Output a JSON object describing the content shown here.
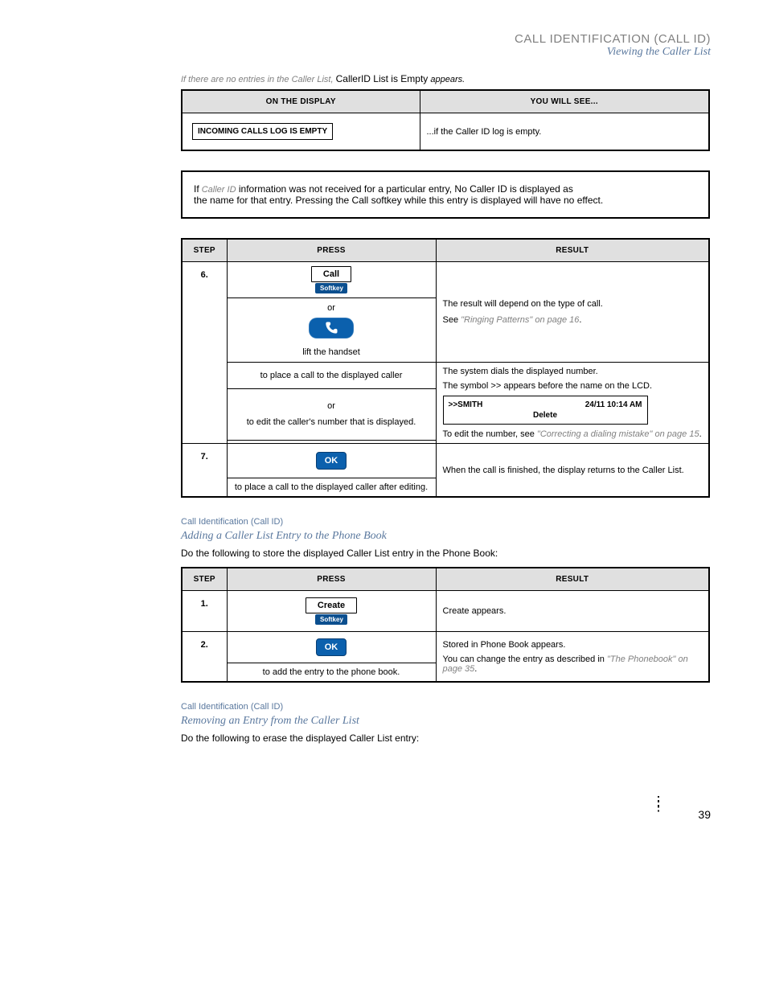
{
  "page": {
    "title": "CALL IDENTIFICATION (CALL ID)",
    "subtitle": "Viewing the Caller List",
    "footer_page": "39"
  },
  "empty_note_prefix": "If there are no entries in the Caller List, ",
  "empty_note_black": "CallerID List is Empty",
  "empty_note_suffix": " appears.",
  "col_step": "Step",
  "col_press": "Press",
  "col_result": "Result",
  "tbl1": {
    "header_left": "ON THE DISPLAY",
    "header_right": "YOU WILL SEE...",
    "empty_log": "INCOMING CALLS LOG IS EMPTY",
    "result": "...if the Caller ID log is empty."
  },
  "msg": {
    "l1_start": "If",
    "l1_em": " Caller ID",
    "l1_end": " information was not received for a particular entry, ",
    "l1_code": "No Caller ID",
    "l1_after": " is displayed as",
    "l2": "the name for that entry. Pressing the",
    "l2_code": " Call",
    "l2_end": " softkey while this entry is displayed will have no effect."
  },
  "tbl2": {
    "r1_step": "6.",
    "r1_softkey": "Call",
    "r1_sub": "Softkey",
    "r1_or": "or",
    "r1_alt": "lift the handset",
    "r1_below": "to place a call to the displayed caller",
    "r1_res1": "The result will depend on the type of call.",
    "r1_res2": "See ",
    "r1_res2_link": "\"Ringing Patterns\" on page 16",
    "r1_res2_end": ".",
    "r2_or": "or",
    "r2_alt": "to edit the caller's number that is displayed.",
    "r2_res_top": "The system dials the displayed number.",
    "r2_res_mid": "The symbol ",
    "r2_res_mid_code": ">>",
    "r2_res_mid_end": " appears before the name on the LCD.",
    "lcd_name": ">>SMITH",
    "lcd_time": "24/11 10:14 AM",
    "lcd_line2": "Delete",
    "r2_res_bot_start": "To edit the number, see",
    "r2_res_bot_link": " \"Correcting a dialing mistake\" on page 15",
    "r2_res_bot_end": ".",
    "r3_step": "7.",
    "r3_ok": "OK",
    "r3_alt": "to place a call to the displayed caller after editing.",
    "r3_res": "When the call is finished, the display returns to the Caller List."
  },
  "sec2": {
    "breadcrumb": "Call Identification (Call ID)",
    "heading": "Adding a Caller List Entry to the Phone Book",
    "intro": "Do the following to store the displayed Caller List entry in the Phone Book:"
  },
  "tbl3": {
    "r1_step": "1.",
    "r1_softkey": "Create",
    "r1_sub": "Softkey",
    "r1_res_start": "Create",
    "r1_res_end": " appears.",
    "r2_step": "2.",
    "r2_ok": "OK",
    "r2_alt": "to add the entry to the phone book.",
    "r2_res1_code": "Stored in Phone Book",
    "r2_res1_end": " appears.",
    "r2_res2_start": "You can change the entry as described in",
    "r2_res2_link": " \"The Phonebook\" on page 35",
    "r2_res2_end": "."
  },
  "sec3": {
    "breadcrumb": "Call Identification (Call ID)",
    "heading": "Removing an Entry from the Caller List",
    "intro": "Do the following to erase the displayed Caller List entry:"
  }
}
